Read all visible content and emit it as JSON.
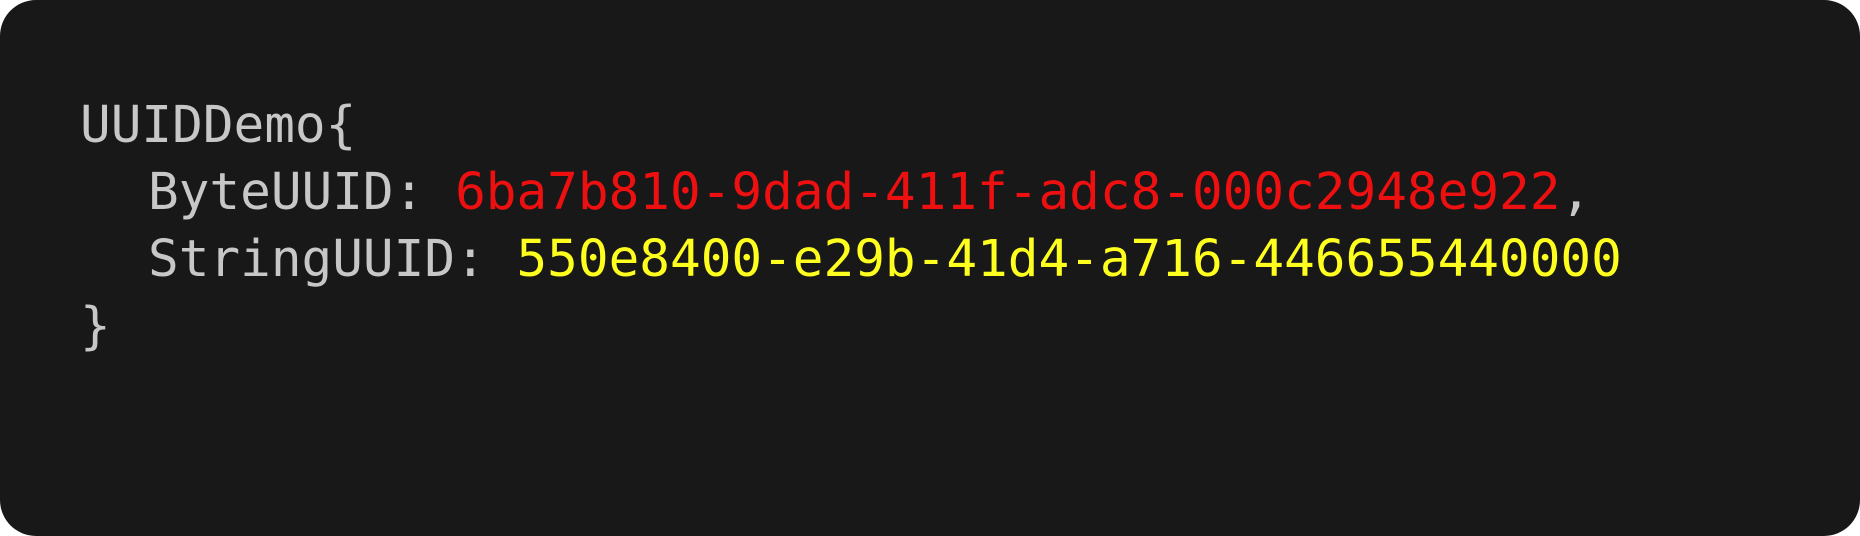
{
  "code": {
    "struct_name": "UUIDDemo",
    "open_brace": "{",
    "close_brace": "}",
    "fields": [
      {
        "key": "ByteUUID",
        "separator": ": ",
        "value": "6ba7b810-9dad-411f-adc8-000c2948e922",
        "trailing": ",",
        "value_color": "#ee1010"
      },
      {
        "key": "StringUUID",
        "separator": ": ",
        "value": "550e8400-e29b-41d4-a716-446655440000",
        "trailing": "",
        "value_color": "#ffff1f"
      }
    ]
  },
  "colors": {
    "background": "#181818",
    "text": "#c7c7c7"
  }
}
